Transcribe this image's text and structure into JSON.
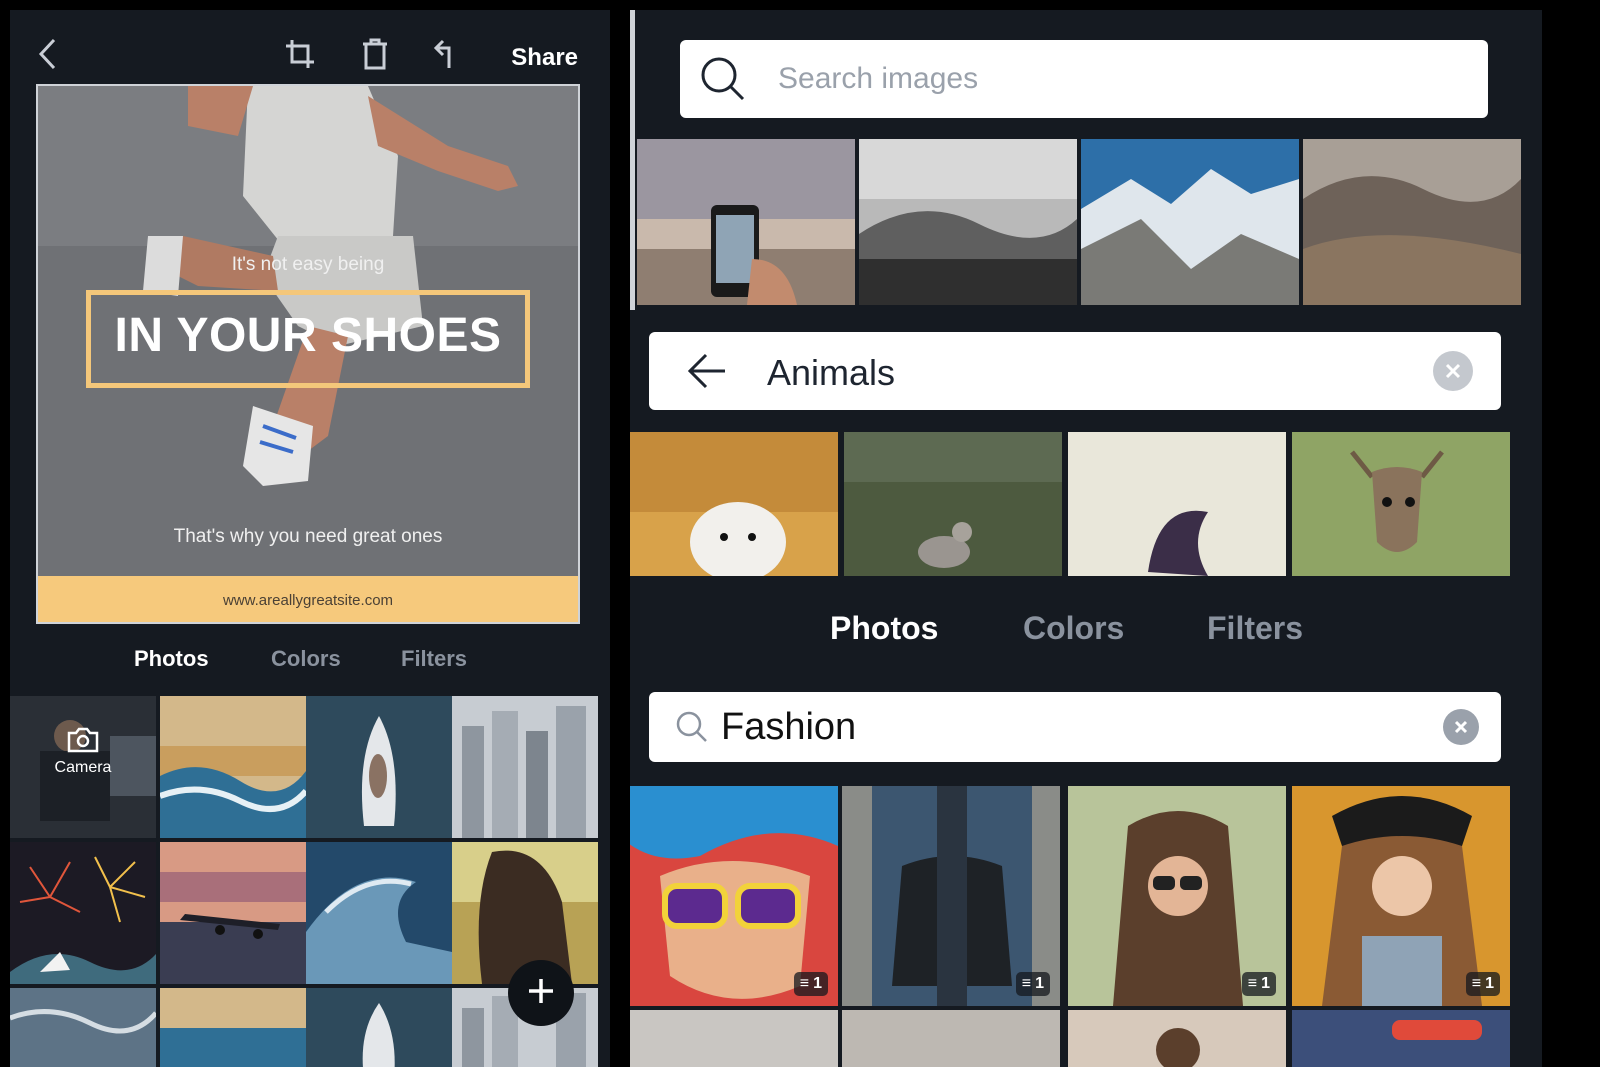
{
  "left_panel": {
    "toolbar": {
      "back_icon": "chevron-left-icon",
      "crop_icon": "crop-icon",
      "delete_icon": "trash-icon",
      "undo_icon": "undo-icon",
      "share_label": "Share"
    },
    "design": {
      "line1": "It's not easy being",
      "headline": "IN YOUR SHOES",
      "line2": "That's why you need great ones",
      "footer_url": "www.areallygreatsite.com",
      "accent_color": "#f6c97c"
    },
    "tabs": [
      {
        "label": "Photos",
        "active": true
      },
      {
        "label": "Colors",
        "active": false
      },
      {
        "label": "Filters",
        "active": false
      }
    ],
    "camera_label": "Camera",
    "add_icon": "plus-icon"
  },
  "right_panel": {
    "search_images": {
      "placeholder": "Search images",
      "icon": "search-icon"
    },
    "animals_search": {
      "query": "Animals",
      "back_icon": "arrow-left-icon",
      "clear_icon": "clear-icon"
    },
    "tabs": [
      {
        "label": "Photos",
        "active": true
      },
      {
        "label": "Colors",
        "active": false
      },
      {
        "label": "Filters",
        "active": false
      }
    ],
    "fashion_search": {
      "query": "Fashion",
      "icon": "search-icon",
      "clear_icon": "clear-icon"
    },
    "fashion_badges": [
      "1",
      "1",
      "1",
      "1"
    ]
  }
}
